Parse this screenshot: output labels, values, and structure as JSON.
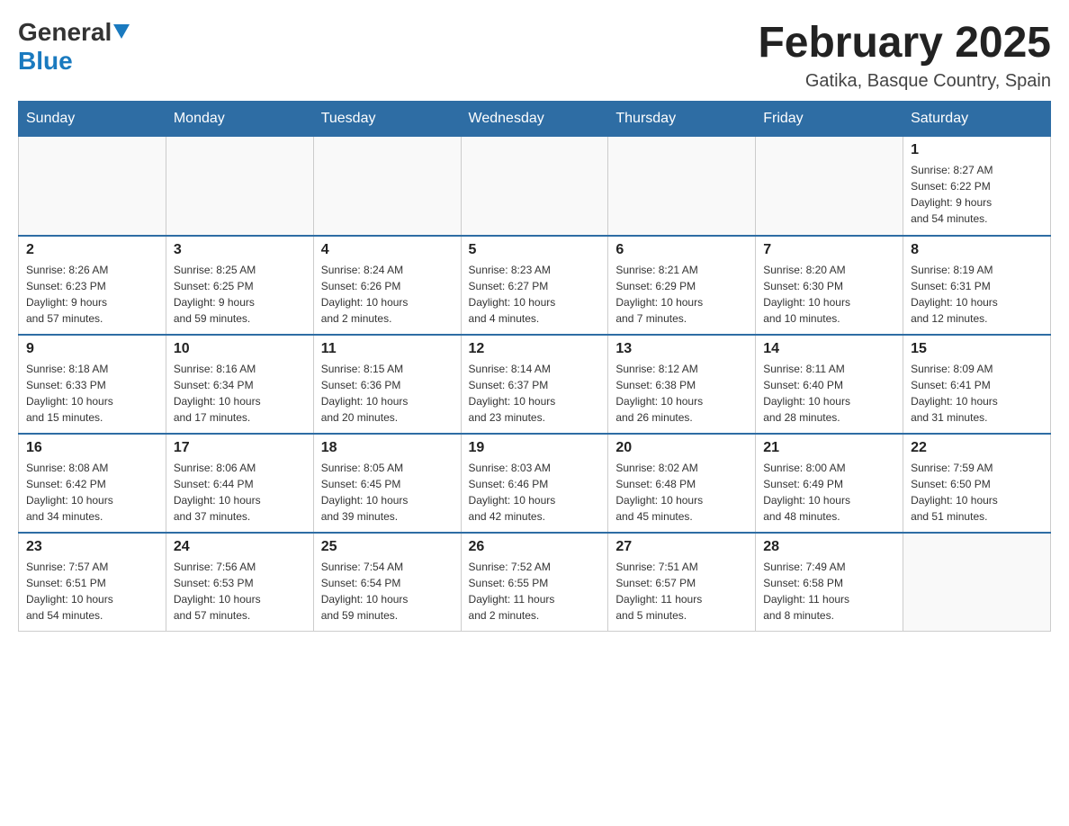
{
  "header": {
    "logo_general": "General",
    "logo_blue": "Blue",
    "month_title": "February 2025",
    "location": "Gatika, Basque Country, Spain"
  },
  "weekdays": [
    "Sunday",
    "Monday",
    "Tuesday",
    "Wednesday",
    "Thursday",
    "Friday",
    "Saturday"
  ],
  "weeks": [
    [
      {
        "day": "",
        "info": ""
      },
      {
        "day": "",
        "info": ""
      },
      {
        "day": "",
        "info": ""
      },
      {
        "day": "",
        "info": ""
      },
      {
        "day": "",
        "info": ""
      },
      {
        "day": "",
        "info": ""
      },
      {
        "day": "1",
        "info": "Sunrise: 8:27 AM\nSunset: 6:22 PM\nDaylight: 9 hours\nand 54 minutes."
      }
    ],
    [
      {
        "day": "2",
        "info": "Sunrise: 8:26 AM\nSunset: 6:23 PM\nDaylight: 9 hours\nand 57 minutes."
      },
      {
        "day": "3",
        "info": "Sunrise: 8:25 AM\nSunset: 6:25 PM\nDaylight: 9 hours\nand 59 minutes."
      },
      {
        "day": "4",
        "info": "Sunrise: 8:24 AM\nSunset: 6:26 PM\nDaylight: 10 hours\nand 2 minutes."
      },
      {
        "day": "5",
        "info": "Sunrise: 8:23 AM\nSunset: 6:27 PM\nDaylight: 10 hours\nand 4 minutes."
      },
      {
        "day": "6",
        "info": "Sunrise: 8:21 AM\nSunset: 6:29 PM\nDaylight: 10 hours\nand 7 minutes."
      },
      {
        "day": "7",
        "info": "Sunrise: 8:20 AM\nSunset: 6:30 PM\nDaylight: 10 hours\nand 10 minutes."
      },
      {
        "day": "8",
        "info": "Sunrise: 8:19 AM\nSunset: 6:31 PM\nDaylight: 10 hours\nand 12 minutes."
      }
    ],
    [
      {
        "day": "9",
        "info": "Sunrise: 8:18 AM\nSunset: 6:33 PM\nDaylight: 10 hours\nand 15 minutes."
      },
      {
        "day": "10",
        "info": "Sunrise: 8:16 AM\nSunset: 6:34 PM\nDaylight: 10 hours\nand 17 minutes."
      },
      {
        "day": "11",
        "info": "Sunrise: 8:15 AM\nSunset: 6:36 PM\nDaylight: 10 hours\nand 20 minutes."
      },
      {
        "day": "12",
        "info": "Sunrise: 8:14 AM\nSunset: 6:37 PM\nDaylight: 10 hours\nand 23 minutes."
      },
      {
        "day": "13",
        "info": "Sunrise: 8:12 AM\nSunset: 6:38 PM\nDaylight: 10 hours\nand 26 minutes."
      },
      {
        "day": "14",
        "info": "Sunrise: 8:11 AM\nSunset: 6:40 PM\nDaylight: 10 hours\nand 28 minutes."
      },
      {
        "day": "15",
        "info": "Sunrise: 8:09 AM\nSunset: 6:41 PM\nDaylight: 10 hours\nand 31 minutes."
      }
    ],
    [
      {
        "day": "16",
        "info": "Sunrise: 8:08 AM\nSunset: 6:42 PM\nDaylight: 10 hours\nand 34 minutes."
      },
      {
        "day": "17",
        "info": "Sunrise: 8:06 AM\nSunset: 6:44 PM\nDaylight: 10 hours\nand 37 minutes."
      },
      {
        "day": "18",
        "info": "Sunrise: 8:05 AM\nSunset: 6:45 PM\nDaylight: 10 hours\nand 39 minutes."
      },
      {
        "day": "19",
        "info": "Sunrise: 8:03 AM\nSunset: 6:46 PM\nDaylight: 10 hours\nand 42 minutes."
      },
      {
        "day": "20",
        "info": "Sunrise: 8:02 AM\nSunset: 6:48 PM\nDaylight: 10 hours\nand 45 minutes."
      },
      {
        "day": "21",
        "info": "Sunrise: 8:00 AM\nSunset: 6:49 PM\nDaylight: 10 hours\nand 48 minutes."
      },
      {
        "day": "22",
        "info": "Sunrise: 7:59 AM\nSunset: 6:50 PM\nDaylight: 10 hours\nand 51 minutes."
      }
    ],
    [
      {
        "day": "23",
        "info": "Sunrise: 7:57 AM\nSunset: 6:51 PM\nDaylight: 10 hours\nand 54 minutes."
      },
      {
        "day": "24",
        "info": "Sunrise: 7:56 AM\nSunset: 6:53 PM\nDaylight: 10 hours\nand 57 minutes."
      },
      {
        "day": "25",
        "info": "Sunrise: 7:54 AM\nSunset: 6:54 PM\nDaylight: 10 hours\nand 59 minutes."
      },
      {
        "day": "26",
        "info": "Sunrise: 7:52 AM\nSunset: 6:55 PM\nDaylight: 11 hours\nand 2 minutes."
      },
      {
        "day": "27",
        "info": "Sunrise: 7:51 AM\nSunset: 6:57 PM\nDaylight: 11 hours\nand 5 minutes."
      },
      {
        "day": "28",
        "info": "Sunrise: 7:49 AM\nSunset: 6:58 PM\nDaylight: 11 hours\nand 8 minutes."
      },
      {
        "day": "",
        "info": ""
      }
    ]
  ]
}
